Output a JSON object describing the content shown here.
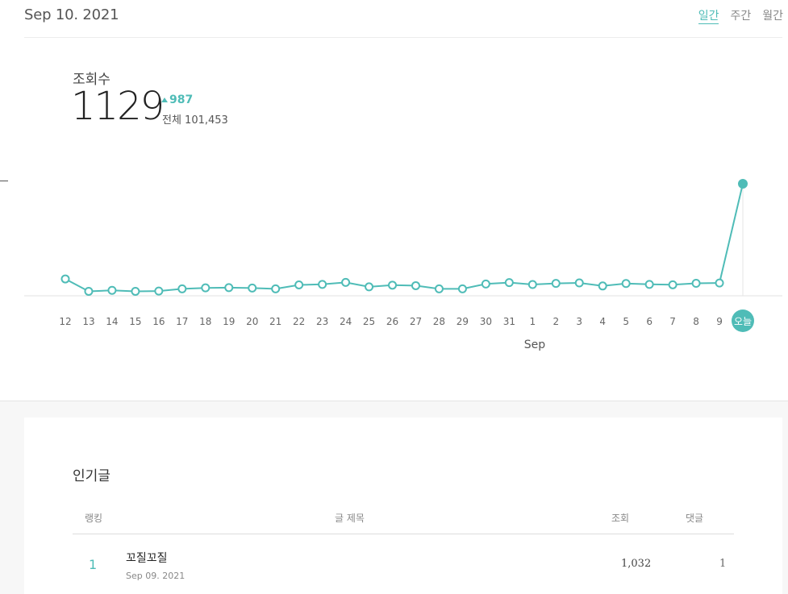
{
  "header": {
    "date": "Sep 10. 2021",
    "tabs": [
      {
        "label": "일간",
        "active": true
      },
      {
        "label": "주간",
        "active": false
      },
      {
        "label": "월간",
        "active": false
      }
    ]
  },
  "metric": {
    "label": "조회수",
    "value": "1129",
    "delta": "987",
    "total": "전체 101,453"
  },
  "colors": {
    "accent": "#4fbcb7"
  },
  "chart_data": {
    "type": "line",
    "categories": [
      "12",
      "13",
      "14",
      "15",
      "16",
      "17",
      "18",
      "19",
      "20",
      "21",
      "22",
      "23",
      "24",
      "25",
      "26",
      "27",
      "28",
      "29",
      "30",
      "31",
      "1",
      "2",
      "3",
      "4",
      "5",
      "6",
      "7",
      "8",
      "9",
      "오늘"
    ],
    "month_label": "Sep",
    "values": [
      170,
      45,
      55,
      45,
      48,
      70,
      80,
      82,
      78,
      70,
      110,
      115,
      135,
      90,
      107,
      102,
      70,
      70,
      119,
      133,
      114,
      125,
      130,
      99,
      124,
      115,
      111,
      126,
      129,
      1129
    ],
    "ylim": [
      0,
      1129
    ],
    "grid": false,
    "legend": "none"
  },
  "popular": {
    "title": "인기글",
    "columns": [
      "랭킹",
      "글 제목",
      "조회",
      "댓글"
    ],
    "rows": [
      {
        "rank": "1",
        "title": "꼬질꼬질",
        "date": "Sep 09. 2021",
        "views": "1,032",
        "comments": "1"
      }
    ]
  }
}
